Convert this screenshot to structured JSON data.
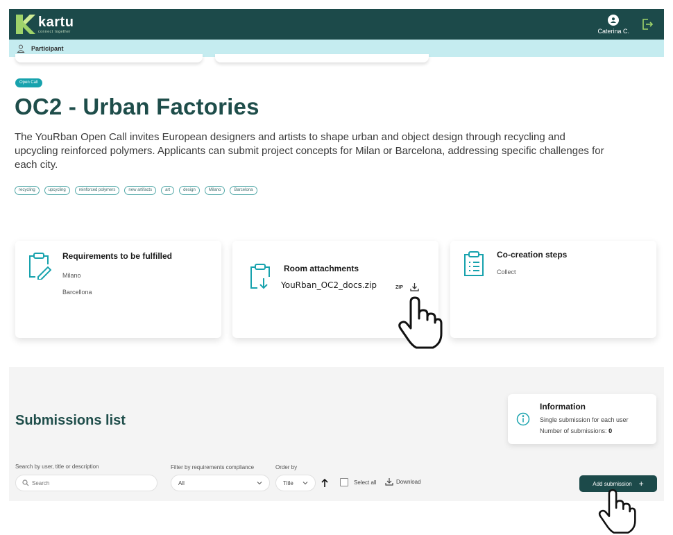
{
  "header": {
    "brand": "kartu",
    "tagline": "connect together",
    "user_name": "Caterina C.",
    "role": "Participant"
  },
  "call": {
    "badge": "Open Call",
    "title": "OC2 - Urban Factories",
    "description": "The YouRban Open Call invites European designers and artists to shape urban and object design through recycling and upcycling reinforced polymers. Applicants can submit project concepts for Milan or Barcelona, addressing specific challenges for each city.",
    "tags": [
      "recycling",
      "upcycling",
      "reinforced polymers",
      "new artifacts",
      "art",
      "design",
      "Milano",
      "Barcelona"
    ]
  },
  "requirements": {
    "title": "Requirements to be fulfilled",
    "items": [
      "Milano",
      "Barcellona"
    ]
  },
  "attachments": {
    "title": "Room attachments",
    "file_name": "YouRban_OC2_docs.zip",
    "file_type": "ZIP"
  },
  "cocreation": {
    "title": "Co-creation steps",
    "items": [
      "Collect"
    ]
  },
  "submissions": {
    "title": "Submissions list",
    "info_title": "Information",
    "info_line1": "Single submission for each user",
    "info_line2_label": "Number of submissions:",
    "info_count": "0",
    "search_label": "Search by user, title or description",
    "search_placeholder": "Search",
    "filter_label": "Filter by requirements compliance",
    "filter_value": "All",
    "order_label": "Order by",
    "order_value": "Title",
    "select_all": "Select all",
    "download": "Download",
    "add_button": "Add submission",
    "add_icon": "+"
  },
  "colors": {
    "brand_dark": "#1c4a4a",
    "brand_light": "#c5ecf0",
    "accent": "#17a2ad",
    "title": "#1e4d4a"
  }
}
